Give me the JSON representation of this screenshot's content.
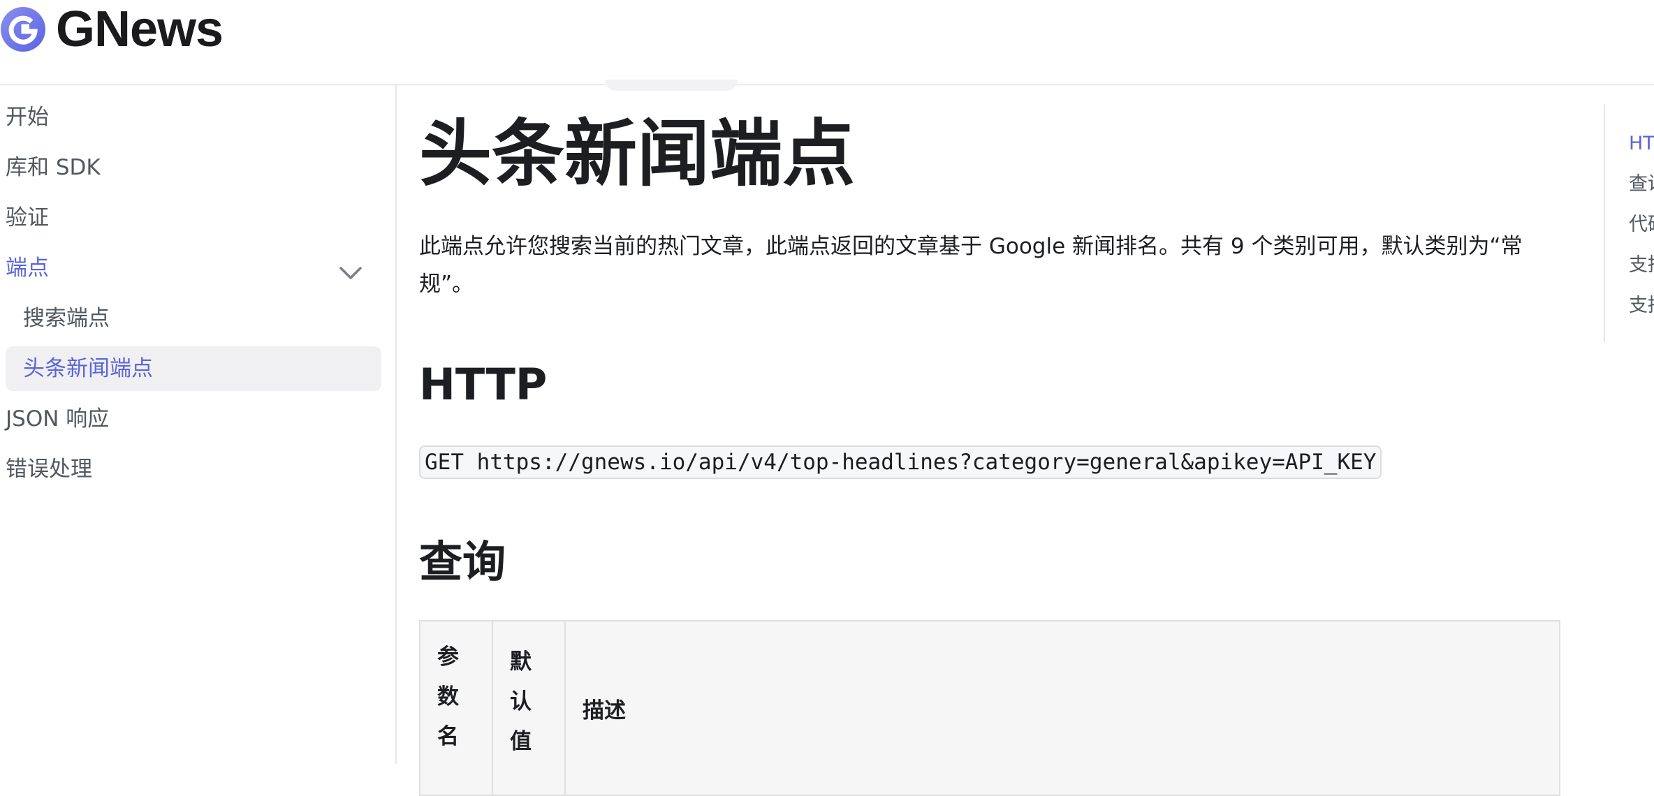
{
  "brand": {
    "name": "GNews",
    "logo_color": "#6b72e8"
  },
  "sidebar": {
    "items": [
      {
        "label": "开始"
      },
      {
        "label": "库和 SDK"
      },
      {
        "label": "验证"
      },
      {
        "label": "端点",
        "expanded": true,
        "active": true
      },
      {
        "label": "JSON 响应"
      },
      {
        "label": "错误处理"
      }
    ],
    "subitems": [
      {
        "label": "搜索端点"
      },
      {
        "label": "头条新闻端点",
        "active": true
      }
    ]
  },
  "main": {
    "title": "头条新闻端点",
    "intro": "此端点允许您搜索当前的热门文章，此端点返回的文章基于 Google 新闻排名。共有 9 个类别可用，默认类别为“常规”。",
    "http_heading": "HTTP",
    "http_request": "GET https://gnews.io/api/v4/top-headlines?category=general&apikey=API_KEY",
    "query_heading": "查询",
    "table_headers": [
      "参数名",
      "默认值",
      "描述"
    ]
  },
  "toc": {
    "items": [
      "HTTP",
      "查询",
      "代码",
      "支持",
      "支持"
    ]
  },
  "colors": {
    "accent": "#5c64d8",
    "text": "#1c1e21",
    "muted": "#525860"
  }
}
